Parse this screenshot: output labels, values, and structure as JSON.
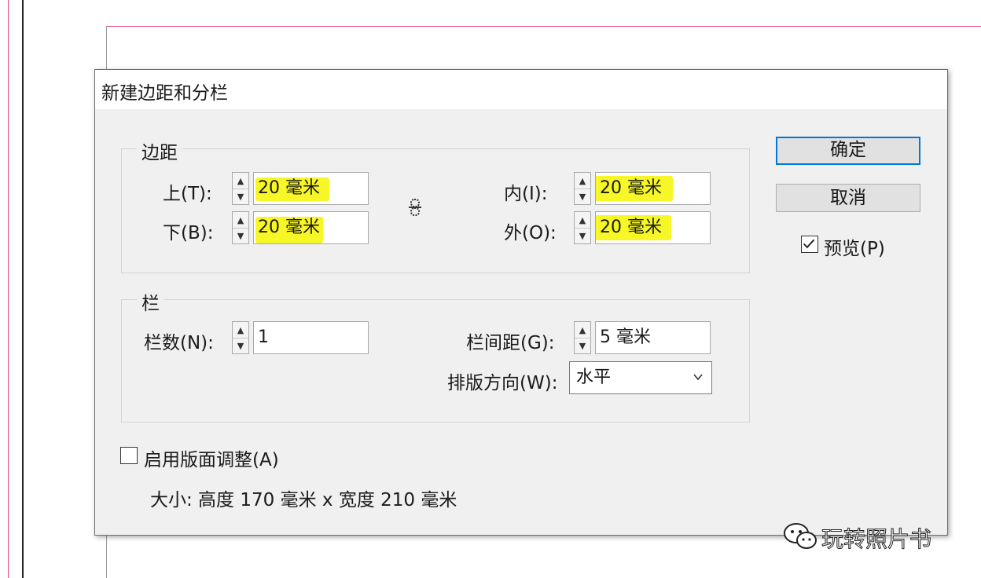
{
  "dialog": {
    "title": "新建边距和分栏"
  },
  "margins": {
    "legend": "边距",
    "top": {
      "label": "上(T):",
      "value": "20 毫米"
    },
    "bottom": {
      "label": "下(B):",
      "value": "20 毫米"
    },
    "inside": {
      "label": "内(I):",
      "value": "20 毫米"
    },
    "outside": {
      "label": "外(O):",
      "value": "20 毫米"
    },
    "link_icon": "chain-link-icon"
  },
  "columns": {
    "legend": "栏",
    "count": {
      "label": "栏数(N):",
      "value": "1"
    },
    "gutter": {
      "label": "栏间距(G):",
      "value": "5 毫米"
    },
    "direction": {
      "label": "排版方向(W):",
      "selected": "水平"
    }
  },
  "buttons": {
    "ok": "确定",
    "cancel": "取消"
  },
  "preview": {
    "label": "预览(P)",
    "checked": true
  },
  "layout_adjust": {
    "label": "启用版面调整(A)",
    "checked": false
  },
  "size_info": "大小: 高度 170 毫米 x 宽度 210 毫米",
  "watermark": {
    "text": "玩转照片书",
    "icon": "wechat-icon"
  },
  "colors": {
    "highlight": "#f6f400",
    "ok_border": "#0078d7",
    "margin_guide": "#e0447a"
  }
}
